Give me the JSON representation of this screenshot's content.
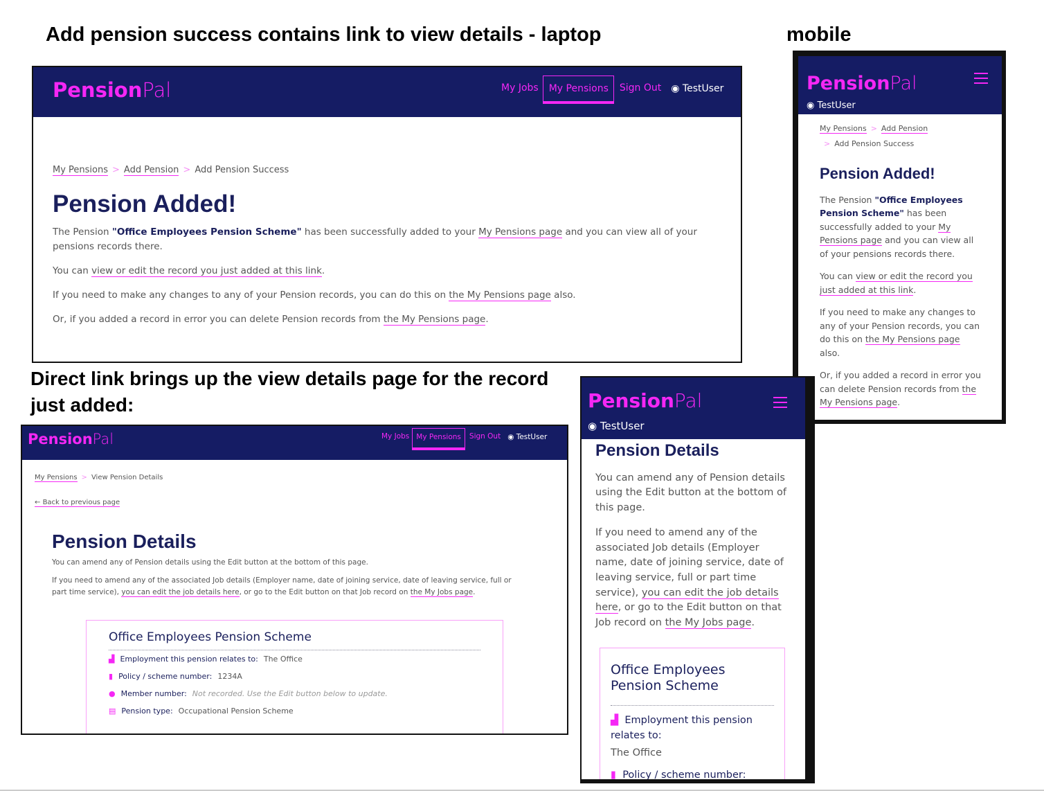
{
  "captions": {
    "laptop": "Add pension success contains link to view details - laptop",
    "mobile": "mobile",
    "direct": "Direct link brings up the view details page for the record just added:"
  },
  "brand": {
    "bold": "Pension",
    "light": "Pal",
    "navy": "#151c64",
    "magenta": "#f527f5"
  },
  "nav": {
    "jobs": "My Jobs",
    "pensions": "My Pensions",
    "signout": "Sign Out",
    "user": "TestUser"
  },
  "success": {
    "crumbs": [
      "My Pensions",
      "Add Pension",
      "Add Pension Success"
    ],
    "heading": "Pension Added!",
    "p1_pre": "The Pension ",
    "p1_name": "\"Office Employees Pension Scheme\"",
    "p1_mid": " has been successfully added to your ",
    "p1_link": "My Pensions page",
    "p1_post": " and you can view all of your pensions records there.",
    "p2_pre": "You can ",
    "p2_link": "view or edit the record you just added at this link",
    "p2_post": ".",
    "p3_pre": "If you need to make any changes to any of your Pension records, you can do this on ",
    "p3_link": "the My Pensions page",
    "p3_post": " also.",
    "p4_pre": "Or, if you added a record in error you can delete Pension records from ",
    "p4_link": "the My Pensions page",
    "p4_post": "."
  },
  "details": {
    "crumbs": [
      "My Pensions",
      "View Pension Details"
    ],
    "back": "Back to previous page",
    "heading": "Pension Details",
    "p1": "You can amend any of Pension details using the Edit button at the bottom of this page.",
    "p2_pre": "If you need to amend any of the associated Job details (Employer name, date of joining service, date of leaving service, full or part time service), ",
    "p2_link": "you can edit the job details here",
    "p2_mid": ", or go to the Edit button on that Job record on ",
    "p2_link2": "the My Jobs page",
    "p2_post": ".",
    "card_title": "Office Employees Pension Scheme",
    "rows": [
      {
        "icon": "building-icon",
        "label": "Employment this pension relates to:",
        "value": "The Office"
      },
      {
        "icon": "paperclip-icon",
        "label": "Policy / scheme number:",
        "value": "1234A"
      },
      {
        "icon": "person-icon",
        "label": "Member number:",
        "value": "Not recorded. Use the Edit button below to update."
      },
      {
        "icon": "document-icon",
        "label": "Pension type:",
        "value": "Occupational Pension Scheme"
      }
    ]
  }
}
